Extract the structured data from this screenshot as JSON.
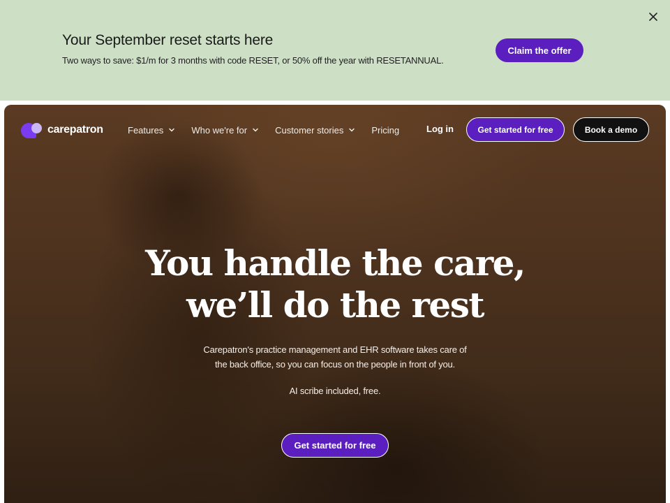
{
  "promo": {
    "title": "Your September reset starts here",
    "text": "Two ways to save: $1/m for 3 months with code RESET, or 50% off the year with RESETANNUAL.",
    "cta_label": "Claim the offer",
    "close_icon": "close-icon",
    "background_color": "#cde0c6"
  },
  "brand": {
    "name": "carepatron",
    "accent_color": "#5b1fc0"
  },
  "nav": {
    "items": [
      {
        "label": "Features",
        "icon": "chevron-down-icon"
      },
      {
        "label": "Who we're for",
        "icon": "chevron-down-icon"
      },
      {
        "label": "Customer stories",
        "icon": "chevron-down-icon"
      },
      {
        "label": "Pricing"
      }
    ],
    "login_label": "Log in",
    "cta_label": "Get started for free",
    "demo_label": "Book a demo"
  },
  "hero": {
    "headline_line1": "You handle the care,",
    "headline_line2": "we’ll do the rest",
    "sub_line1": "Carepatron's practice management and EHR software takes care of",
    "sub_line2": "the back office, so you can focus on the people in front of you.",
    "ai_note": "AI scribe included, free.",
    "cta_label": "Get started for free"
  }
}
